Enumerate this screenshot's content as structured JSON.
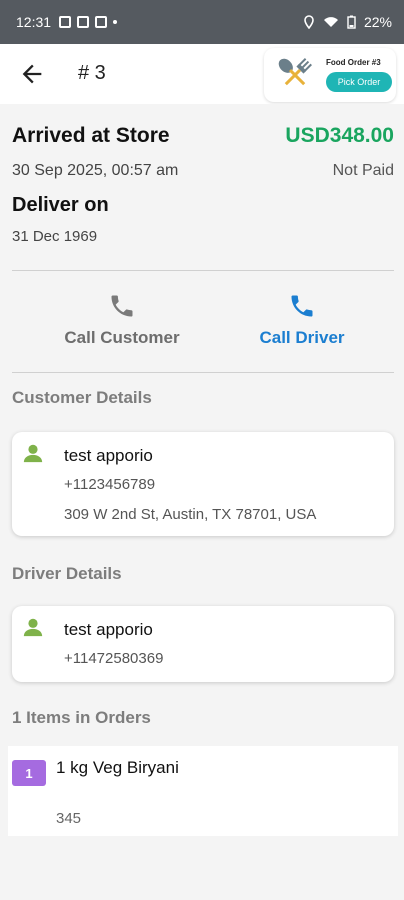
{
  "status_bar": {
    "time": "12:31",
    "battery": "22%"
  },
  "header": {
    "order_number": "# 3",
    "badge": {
      "label": "Food Order #3",
      "button": "Pick Order"
    }
  },
  "order": {
    "status": "Arrived at Store",
    "amount": "USD348.00",
    "amount_color": "#1aa55f",
    "date": "30 Sep 2025, 00:57 am",
    "payment_status": "Not Paid",
    "deliver_label": "Deliver on",
    "deliver_date": "31 Dec 1969"
  },
  "actions": {
    "call_customer": "Call Customer",
    "call_driver": "Call Driver",
    "driver_color": "#1b7ed0"
  },
  "customer": {
    "section_title": "Customer Details",
    "name": "test apporio",
    "phone": "+1123456789",
    "address": "309 W 2nd St, Austin, TX 78701, USA"
  },
  "driver": {
    "section_title": "Driver Details",
    "name": "test apporio",
    "phone": "+11472580369"
  },
  "items": {
    "section_title": "1 Items in Orders",
    "list": [
      {
        "qty": "1",
        "name": "1 kg Veg Biryani",
        "note": "345"
      }
    ]
  },
  "icons": {
    "back": "arrow-left-icon",
    "phone": "phone-icon",
    "person": "person-icon",
    "food": "spoon-fork-icon"
  }
}
